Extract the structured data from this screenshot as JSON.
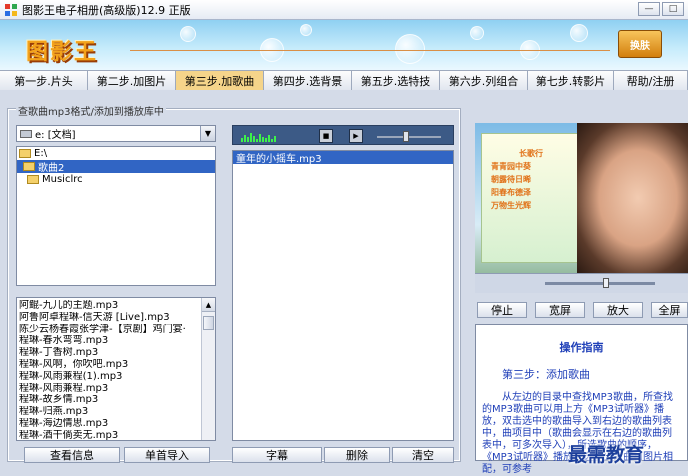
{
  "window": {
    "title": "图影王电子相册(高级版)12.9 正版"
  },
  "banner": {
    "logo_text": "图影王",
    "button_label": "换肤"
  },
  "tabs": [
    {
      "label": "第一步.片头",
      "active": false
    },
    {
      "label": "第二步.加图片",
      "active": false
    },
    {
      "label": "第三步.加歌曲",
      "active": true
    },
    {
      "label": "第四步.选背景",
      "active": false
    },
    {
      "label": "第五步.选特技",
      "active": false
    },
    {
      "label": "第六步.列组合",
      "active": false
    },
    {
      "label": "第七步.转影片",
      "active": false
    },
    {
      "label": "帮助/注册",
      "active": false
    }
  ],
  "left_panel": {
    "group_label": "查歌曲mp3格式/添加到播放库中",
    "drive_select": "e: [文档]",
    "folders": [
      {
        "name": "E:\\",
        "selected": false,
        "indent": 0
      },
      {
        "name": "歌曲2",
        "selected": true,
        "indent": 1
      },
      {
        "name": "Musiclrc",
        "selected": false,
        "indent": 1
      }
    ],
    "files": [
      "阿鲲-九儿的主题.mp3",
      "阿鲁阿卓程琳-信天游 [Live].mp3",
      "陈少云杨春霞张学津-【京剧】鸡门宴·",
      "程琳-春水弯弯.mp3",
      "程琳-丁香树.mp3",
      "程琳-风啊，你吹吧.mp3",
      "程琳-风雨兼程(1).mp3",
      "程琳-风雨兼程.mp3",
      "程琳-故乡情.mp3",
      "程琳-归燕.mp3",
      "程琳-海边情思.mp3",
      "程琳-酒干倘卖无.mp3"
    ],
    "buttons": {
      "view_info": "查看信息",
      "import_single": "单首导入"
    }
  },
  "middle_panel": {
    "playlist": [
      "童年的小摇车.mp3"
    ],
    "buttons": {
      "subtitle": "字幕",
      "delete": "删除",
      "clear": "清空"
    }
  },
  "right_panel": {
    "preview_poem": [
      "长歌行",
      "青青园中葵",
      "朝露待日晞",
      "阳春布德泽",
      "万物生光辉"
    ],
    "buttons": {
      "stop": "停止",
      "widescreen": "宽屏",
      "zoom_in": "放大",
      "fullscreen": "全屏"
    },
    "guide": {
      "title": "操作指南",
      "step": "第三步：添加歌曲",
      "body": "从左边的目录中查找MP3歌曲，所查找的MP3歌曲可以用上方《MP3试听器》播放，双击选中的歌曲导入到右边的歌曲列表中，曲项目中（歌曲会显示在右边的歌曲列表中，可多次导入），所选歌曲的顺序，《MP3试听器》播放，选步少歌曲和图片相配，可参考"
    }
  },
  "watermark": {
    "text": "最需教育"
  },
  "colors": {
    "selection": "#3165c4",
    "guide_text": "#1f3fb8",
    "active_tab": "#f5d48a",
    "logo": "#f3a21b"
  }
}
